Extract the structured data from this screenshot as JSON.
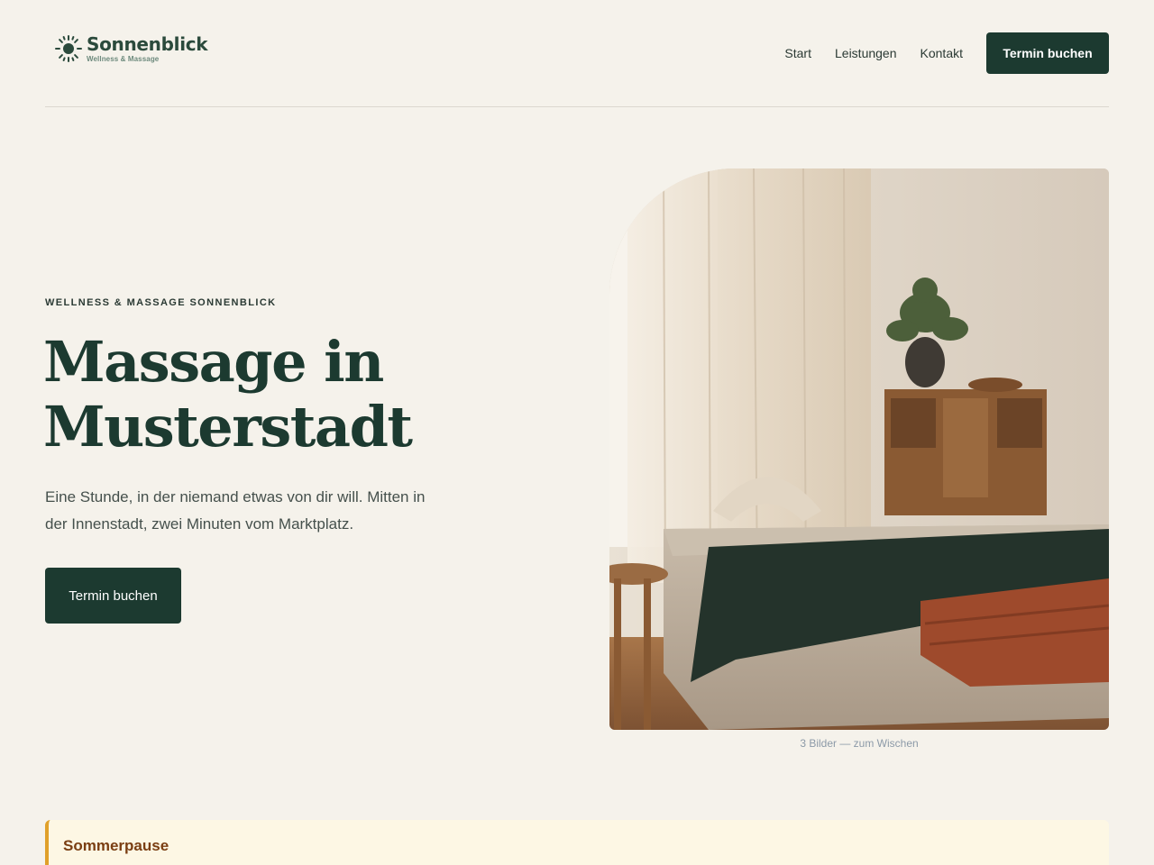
{
  "brand": {
    "name": "Sonnenblick",
    "tagline": "Wellness & Massage"
  },
  "nav": {
    "items": [
      {
        "label": "Start"
      },
      {
        "label": "Leistungen"
      },
      {
        "label": "Kontakt"
      }
    ],
    "cta_label": "Termin buchen"
  },
  "hero": {
    "eyebrow": "WELLNESS & MASSAGE SONNENBLICK",
    "title_line1": "Massage in",
    "title_line2": "Musterstadt",
    "text": "Eine Stunde, in der niemand etwas von dir will. Mitten in der Innenstadt, zwei Minuten vom Marktplatz.",
    "cta_label": "Termin buchen",
    "gallery_caption": "3 Bilder — zum Wischen"
  },
  "notice": {
    "title": "Sommerpause"
  },
  "colors": {
    "background": "#f5f2eb",
    "primary": "#1c3a30",
    "notice_bg": "#fdf7e4",
    "notice_accent": "#e0a02a",
    "notice_text": "#7a3e12"
  },
  "icons": {
    "logo": "sun-icon"
  }
}
